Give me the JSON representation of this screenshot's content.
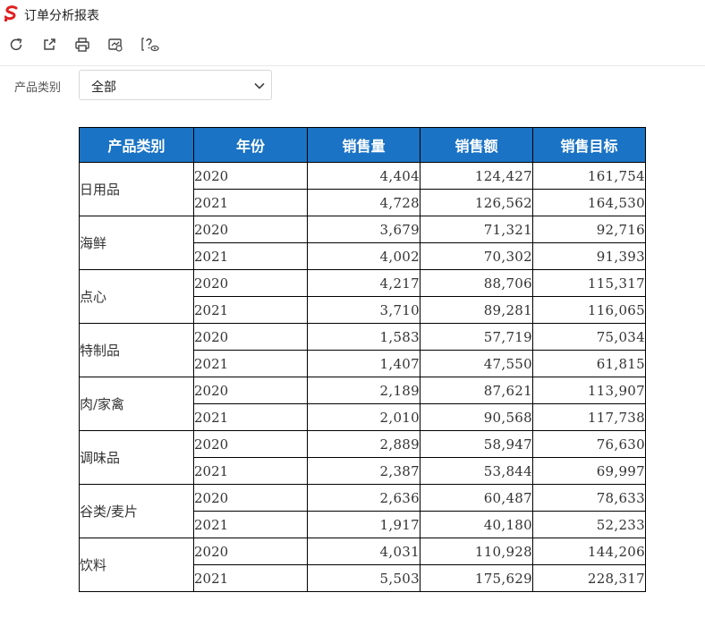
{
  "app": {
    "title": "订单分析报表"
  },
  "toolbar": {
    "buttons": [
      {
        "icon": "refresh-icon"
      },
      {
        "icon": "external-link-icon"
      },
      {
        "icon": "print-icon"
      },
      {
        "icon": "export-icon"
      },
      {
        "icon": "help-icon"
      }
    ]
  },
  "filter": {
    "label": "产品类别",
    "selected": "全部"
  },
  "table": {
    "headers": [
      "产品类别",
      "年份",
      "销售量",
      "销售额",
      "销售目标"
    ],
    "groups": [
      {
        "category": "日用品",
        "rows": [
          {
            "year": "2020",
            "qty": "4,404",
            "amount": "124,427",
            "target": "161,754"
          },
          {
            "year": "2021",
            "qty": "4,728",
            "amount": "126,562",
            "target": "164,530"
          }
        ]
      },
      {
        "category": "海鲜",
        "rows": [
          {
            "year": "2020",
            "qty": "3,679",
            "amount": "71,321",
            "target": "92,716"
          },
          {
            "year": "2021",
            "qty": "4,002",
            "amount": "70,302",
            "target": "91,393"
          }
        ]
      },
      {
        "category": "点心",
        "rows": [
          {
            "year": "2020",
            "qty": "4,217",
            "amount": "88,706",
            "target": "115,317"
          },
          {
            "year": "2021",
            "qty": "3,710",
            "amount": "89,281",
            "target": "116,065"
          }
        ]
      },
      {
        "category": "特制品",
        "rows": [
          {
            "year": "2020",
            "qty": "1,583",
            "amount": "57,719",
            "target": "75,034"
          },
          {
            "year": "2021",
            "qty": "1,407",
            "amount": "47,550",
            "target": "61,815"
          }
        ]
      },
      {
        "category": "肉/家禽",
        "rows": [
          {
            "year": "2020",
            "qty": "2,189",
            "amount": "87,621",
            "target": "113,907"
          },
          {
            "year": "2021",
            "qty": "2,010",
            "amount": "90,568",
            "target": "117,738"
          }
        ]
      },
      {
        "category": "调味品",
        "rows": [
          {
            "year": "2020",
            "qty": "2,889",
            "amount": "58,947",
            "target": "76,630"
          },
          {
            "year": "2021",
            "qty": "2,387",
            "amount": "53,844",
            "target": "69,997"
          }
        ]
      },
      {
        "category": "谷类/麦片",
        "rows": [
          {
            "year": "2020",
            "qty": "2,636",
            "amount": "60,487",
            "target": "78,633"
          },
          {
            "year": "2021",
            "qty": "1,917",
            "amount": "40,180",
            "target": "52,233"
          }
        ]
      },
      {
        "category": "饮料",
        "rows": [
          {
            "year": "2020",
            "qty": "4,031",
            "amount": "110,928",
            "target": "144,206"
          },
          {
            "year": "2021",
            "qty": "5,503",
            "amount": "175,629",
            "target": "228,317"
          }
        ]
      }
    ]
  },
  "colors": {
    "header_bg": "#1a73c5",
    "logo_red": "#e02020"
  }
}
